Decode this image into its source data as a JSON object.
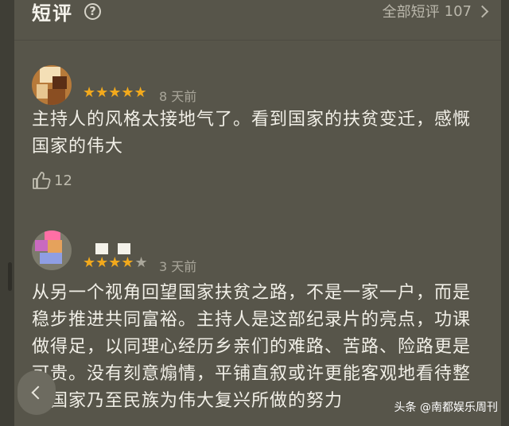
{
  "header": {
    "title": "短评",
    "help_glyph": "?",
    "all_label": "全部短评",
    "all_count": "107"
  },
  "reviews": [
    {
      "rating": 5,
      "stars": "★★★★★",
      "date": "8 天前",
      "text": "主持人的风格太接地气了。看到国家的扶贫变迁，感慨国家的伟大",
      "likes": "12"
    },
    {
      "rating": 4,
      "stars_on": "★★★★",
      "stars_off": "★",
      "date": "3 天前",
      "text": "从另一个视角回望国家扶贫之路，不是一家一户，而是稳步推进共同富裕。主持人是这部纪录片的亮点，功课做得足，以同理心经历乡亲们的难路、苦路、险路更是可贵。没有刻意煽情，平铺直叙或许更能客观地看待整个国家乃至民族为伟大复兴所做的努力"
    }
  ],
  "watermark": {
    "text": "头条 @南都娱乐周刊"
  },
  "colors": {
    "background": "#57554a",
    "star": "#f2a91c",
    "star_off": "#a9a69a",
    "text": "#f1efe7"
  }
}
